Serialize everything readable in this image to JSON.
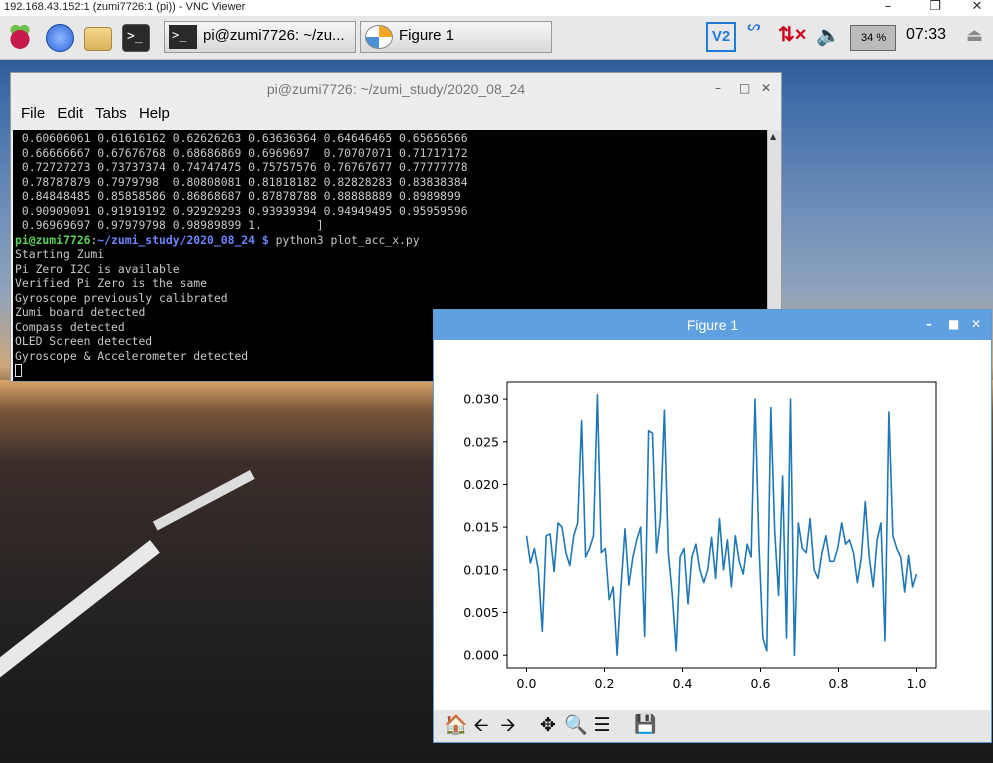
{
  "vnc": {
    "title": "192.168.43.152:1 (zumi7726:1 (pi)) - VNC Viewer"
  },
  "taskbar": {
    "terminal_task": "pi@zumi7726: ~/zu...",
    "figure_task": "Figure 1",
    "battery_percent": "34",
    "battery_unit": "%",
    "clock": "07:33"
  },
  "terminal": {
    "title": "pi@zumi7726: ~/zumi_study/2020_08_24",
    "menu": [
      "File",
      "Edit",
      "Tabs",
      "Help"
    ],
    "output_lines": [
      " 0.60606061 0.61616162 0.62626263 0.63636364 0.64646465 0.65656566",
      " 0.66666667 0.67676768 0.68686869 0.6969697  0.70707071 0.71717172",
      " 0.72727273 0.73737374 0.74747475 0.75757576 0.76767677 0.77777778",
      " 0.78787879 0.7979798  0.80808081 0.81818182 0.82828283 0.83838384",
      " 0.84848485 0.85858586 0.86868687 0.87878788 0.88888889 0.8989899",
      " 0.90909091 0.91919192 0.92929293 0.93939394 0.94949495 0.95959596",
      " 0.96969697 0.97979798 0.98989899 1.        ]"
    ],
    "prompt_user": "pi@zumi7726",
    "prompt_sep": ":",
    "prompt_path": "~/zumi_study/2020_08_24",
    "prompt_dollar": " $ ",
    "command": "python3 plot_acc_x.py",
    "log_lines": [
      "Starting Zumi",
      "Pi Zero I2C is available",
      "Verified Pi Zero is the same",
      "Gyroscope previously calibrated",
      "Zumi board detected",
      "Compass detected",
      "OLED Screen detected",
      "Gyroscope & Accelerometer detected"
    ]
  },
  "figure": {
    "title": "Figure 1",
    "toolbar": [
      "home-icon",
      "back-arrow-icon",
      "forward-arrow-icon",
      "pan-icon",
      "zoom-icon",
      "configure-subplots-icon",
      "save-icon"
    ]
  },
  "chart_data": {
    "type": "line",
    "title": "",
    "xlabel": "",
    "ylabel": "",
    "xlim": [
      -0.05,
      1.05
    ],
    "ylim": [
      -0.0015,
      0.032
    ],
    "xticks": [
      "0.0",
      "0.2",
      "0.4",
      "0.6",
      "0.8",
      "1.0"
    ],
    "xtick_values": [
      0.0,
      0.2,
      0.4,
      0.6,
      0.8,
      1.0
    ],
    "yticks": [
      "0.000",
      "0.005",
      "0.010",
      "0.015",
      "0.020",
      "0.025",
      "0.030"
    ],
    "ytick_values": [
      0.0,
      0.005,
      0.01,
      0.015,
      0.02,
      0.025,
      0.03
    ],
    "color": "#1f77b4",
    "x": [
      0.0,
      0.0101,
      0.0202,
      0.0303,
      0.0404,
      0.0505,
      0.0606,
      0.0707,
      0.0808,
      0.0909,
      0.101,
      0.1111,
      0.1212,
      0.1313,
      0.1414,
      0.1515,
      0.1616,
      0.1717,
      0.1818,
      0.1919,
      0.202,
      0.2121,
      0.2222,
      0.2323,
      0.2424,
      0.2525,
      0.2626,
      0.2727,
      0.2828,
      0.2929,
      0.303,
      0.3131,
      0.3232,
      0.3333,
      0.3434,
      0.3535,
      0.3636,
      0.3737,
      0.3838,
      0.3939,
      0.404,
      0.4141,
      0.4242,
      0.4343,
      0.4444,
      0.4545,
      0.4646,
      0.4747,
      0.4848,
      0.4949,
      0.5051,
      0.5152,
      0.5253,
      0.5354,
      0.5455,
      0.5556,
      0.5657,
      0.5758,
      0.5859,
      0.596,
      0.6061,
      0.6162,
      0.6263,
      0.6364,
      0.6465,
      0.6566,
      0.6667,
      0.6768,
      0.6869,
      0.697,
      0.7071,
      0.7172,
      0.7273,
      0.7374,
      0.7475,
      0.7576,
      0.7677,
      0.7778,
      0.7879,
      0.798,
      0.8081,
      0.8182,
      0.8283,
      0.8384,
      0.8485,
      0.8586,
      0.8687,
      0.8788,
      0.8889,
      0.899,
      0.9091,
      0.9192,
      0.9293,
      0.9394,
      0.9495,
      0.9596,
      0.9697,
      0.9798,
      0.9899,
      1.0
    ],
    "y": [
      0.014,
      0.0108,
      0.0125,
      0.01,
      0.0028,
      0.014,
      0.0142,
      0.0098,
      0.0155,
      0.015,
      0.012,
      0.0105,
      0.014,
      0.0155,
      0.0275,
      0.0115,
      0.0125,
      0.014,
      0.0305,
      0.012,
      0.0125,
      0.0065,
      0.008,
      0.0,
      0.008,
      0.0148,
      0.0082,
      0.0115,
      0.0135,
      0.015,
      0.0022,
      0.0263,
      0.026,
      0.012,
      0.016,
      0.0287,
      0.012,
      0.0072,
      0.0005,
      0.0115,
      0.0125,
      0.006,
      0.0115,
      0.013,
      0.01,
      0.0085,
      0.01,
      0.0138,
      0.009,
      0.016,
      0.01,
      0.0135,
      0.008,
      0.014,
      0.011,
      0.0095,
      0.013,
      0.0115,
      0.03,
      0.013,
      0.002,
      0.0005,
      0.029,
      0.0145,
      0.007,
      0.021,
      0.002,
      0.03,
      0.0,
      0.0155,
      0.0125,
      0.012,
      0.016,
      0.01,
      0.009,
      0.012,
      0.014,
      0.011,
      0.011,
      0.0125,
      0.0155,
      0.013,
      0.0135,
      0.012,
      0.0085,
      0.0115,
      0.018,
      0.0115,
      0.008,
      0.0135,
      0.0155,
      0.0017,
      0.0285,
      0.014,
      0.0125,
      0.0115,
      0.0074,
      0.0117,
      0.008,
      0.0095
    ]
  }
}
